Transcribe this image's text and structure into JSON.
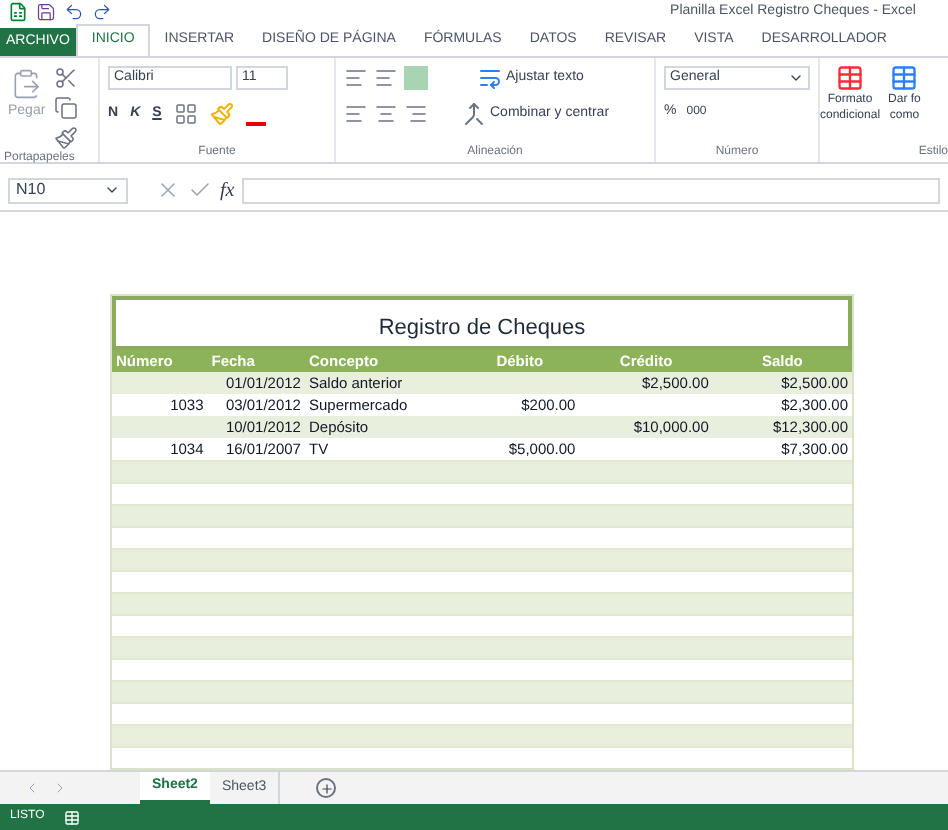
{
  "window": {
    "title": "Planilla Excel Registro Cheques - Excel"
  },
  "tabs": [
    {
      "label": "ARCHIVO",
      "kind": "file",
      "selected": false
    },
    {
      "label": "INICIO",
      "kind": "tab",
      "selected": true
    },
    {
      "label": "INSERTAR",
      "kind": "tab",
      "selected": false
    },
    {
      "label": "DISEÑO DE PÁGINA",
      "kind": "tab",
      "selected": false
    },
    {
      "label": "FÓRMULAS",
      "kind": "tab",
      "selected": false
    },
    {
      "label": "DATOS",
      "kind": "tab",
      "selected": false
    },
    {
      "label": "REVISAR",
      "kind": "tab",
      "selected": false
    },
    {
      "label": "VISTA",
      "kind": "tab",
      "selected": false
    },
    {
      "label": "DESARROLLADOR",
      "kind": "tab",
      "selected": false
    }
  ],
  "ribbon": {
    "paste": "Pegar",
    "font_name": "Calibri",
    "font_size": "11",
    "bold": "N",
    "italic": "K",
    "underline": "S",
    "wrap": "Ajustar texto",
    "merge": "Combinar y centrar",
    "number_format": "General",
    "percent": "%",
    "thousands": "000",
    "conditional": [
      "Formato",
      "condicional"
    ],
    "format_as": [
      "Dar fo",
      "como"
    ],
    "groups": [
      "Portapapeles",
      "Fuente",
      "Alineación",
      "Número",
      "Estilo"
    ]
  },
  "formula_bar": {
    "name_box": "N10",
    "fx": "fx"
  },
  "sheet": {
    "title": "Registro de Cheques",
    "columns": [
      "Número",
      "Fecha",
      "Concepto",
      "Débito",
      "Crédito",
      "Saldo"
    ],
    "rows": [
      [
        "",
        "01/01/2012",
        "Saldo anterior",
        "",
        "$2,500.00",
        "$2,500.00"
      ],
      [
        "1033",
        "03/01/2012",
        "Supermercado",
        "$200.00",
        "",
        "$2,300.00"
      ],
      [
        "",
        "10/01/2012",
        "Depósito",
        "",
        "$10,000.00",
        "$12,300.00"
      ],
      [
        "1034",
        "16/01/2007",
        "TV",
        "$5,000.00",
        "",
        "$7,300.00"
      ]
    ]
  },
  "sheet_tabs": [
    {
      "label": "Sheet2",
      "selected": true
    },
    {
      "label": "Sheet3",
      "selected": false
    }
  ],
  "status_bar": {
    "text": "LISTO"
  }
}
